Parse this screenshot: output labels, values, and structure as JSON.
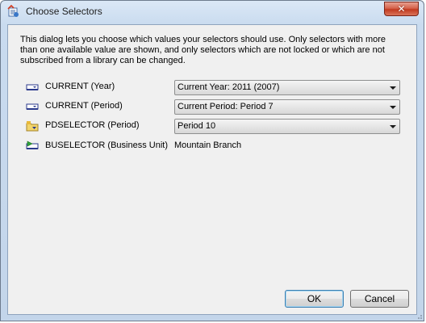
{
  "window": {
    "title": "Choose Selectors",
    "close_glyph": "✕",
    "app_icon": "report-app-icon"
  },
  "description": "This dialog lets you choose which values your selectors should use. Only selectors with more than one available value are shown, and only selectors which are not locked or which are not subscribed from a library can be changed.",
  "selectors": [
    {
      "label": "CURRENT (Year)",
      "icon": "current-selector-icon",
      "value": "Current Year: 2011 (2007)",
      "type": "dropdown"
    },
    {
      "label": "CURRENT (Period)",
      "icon": "current-selector-icon",
      "value": "Current Period: Period 7",
      "type": "dropdown"
    },
    {
      "label": "PDSELECTOR (Period)",
      "icon": "folder-selector-icon",
      "value": "Period 10",
      "type": "dropdown"
    },
    {
      "label": "BUSELECTOR (Business Unit)",
      "icon": "green-arrow-selector-icon",
      "value": "Mountain Branch",
      "type": "static"
    }
  ],
  "buttons": {
    "ok_label": "OK",
    "cancel_label": "Cancel"
  },
  "colors": {
    "title_gradient_top": "#dbe8f6",
    "client_bg": "#f0f0f0",
    "close_red": "#c23b20",
    "default_button_border": "#3c7fb1"
  }
}
